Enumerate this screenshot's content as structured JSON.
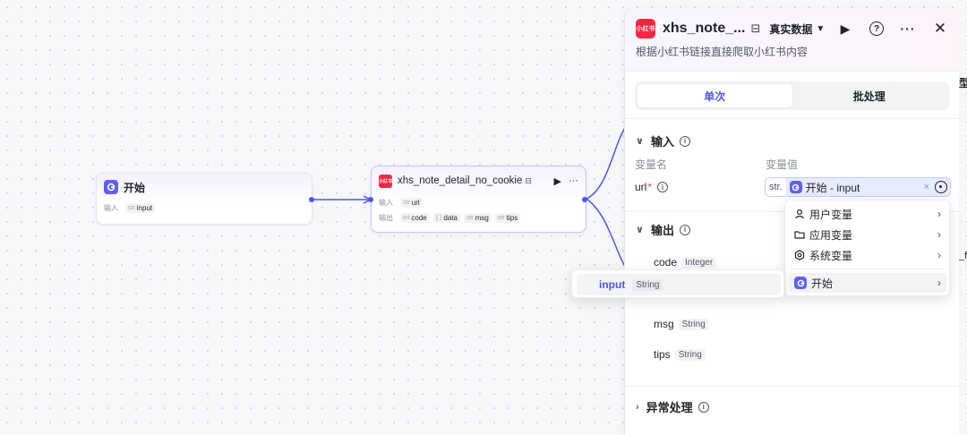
{
  "canvas": {
    "start_node": {
      "title": "开始",
      "input_label": "输入",
      "input_param": {
        "type": "str",
        "name": "input"
      }
    },
    "xhs_node": {
      "badge": "小红书",
      "title": "xhs_note_detail_no_cookie",
      "more": "···",
      "input_label": "输入",
      "input_param": {
        "type": "str",
        "name": "url"
      },
      "output_label": "输出",
      "output_params": [
        {
          "type": "int",
          "name": "code"
        },
        {
          "type": "{ }",
          "name": "data"
        },
        {
          "type": "str",
          "name": "msg"
        },
        {
          "type": "str",
          "name": "tips"
        }
      ]
    }
  },
  "panel": {
    "logo_text": "小红书",
    "title": "xhs_note_...",
    "mode": "真实数据",
    "description": "根据小红书链接直接爬取小红书内容",
    "tabs": [
      {
        "label": "单次",
        "active": true
      },
      {
        "label": "批处理",
        "active": false
      }
    ],
    "input_section": {
      "title": "输入",
      "col_name": "变量名",
      "col_value": "变量值",
      "field": {
        "name": "url",
        "required_mark": "*",
        "type_prefix": "str.",
        "value": "开始 - input",
        "clear": "×"
      }
    },
    "output_section": {
      "title": "输出",
      "items": [
        {
          "name": "code",
          "type": "Integer"
        },
        {
          "name": "msg",
          "type": "String"
        },
        {
          "name": "tips",
          "type": "String"
        }
      ]
    },
    "error_section": {
      "title": "异常处理"
    }
  },
  "variable_menu": {
    "items": [
      {
        "label": "用户变量",
        "icon": "user-icon"
      },
      {
        "label": "应用变量",
        "icon": "folder-icon"
      },
      {
        "label": "系统变量",
        "icon": "gear-icon"
      },
      {
        "label": "开始",
        "icon": "start-node-icon",
        "highlighted": true
      }
    ]
  },
  "sub_menu": {
    "item": {
      "name": "input",
      "type": "String"
    }
  },
  "colors": {
    "accent": "#4e55f0",
    "start_badge": "#5b61f6",
    "xhs_red": "#ff2442"
  }
}
